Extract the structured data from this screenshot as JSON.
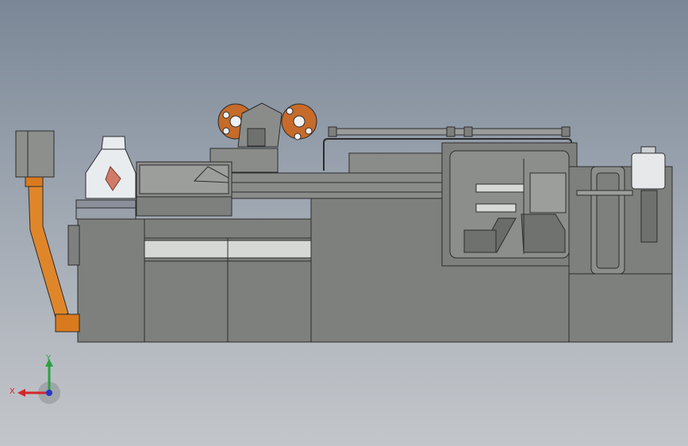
{
  "viewport": {
    "background_top": "#7b8797",
    "background_bottom": "#c3c6ca"
  },
  "machine": {
    "body_color": "#7e807e",
    "edge_color": "#2c2c2c",
    "accent_color": "#d97a1f",
    "panel_light": "#d6d8d6",
    "glass_color": "#e9ecef"
  },
  "triad": {
    "x_label": "X",
    "y_label": "Y",
    "x_color": "#d3272b",
    "y_color": "#2ea043",
    "z_color": "#2436c8"
  }
}
